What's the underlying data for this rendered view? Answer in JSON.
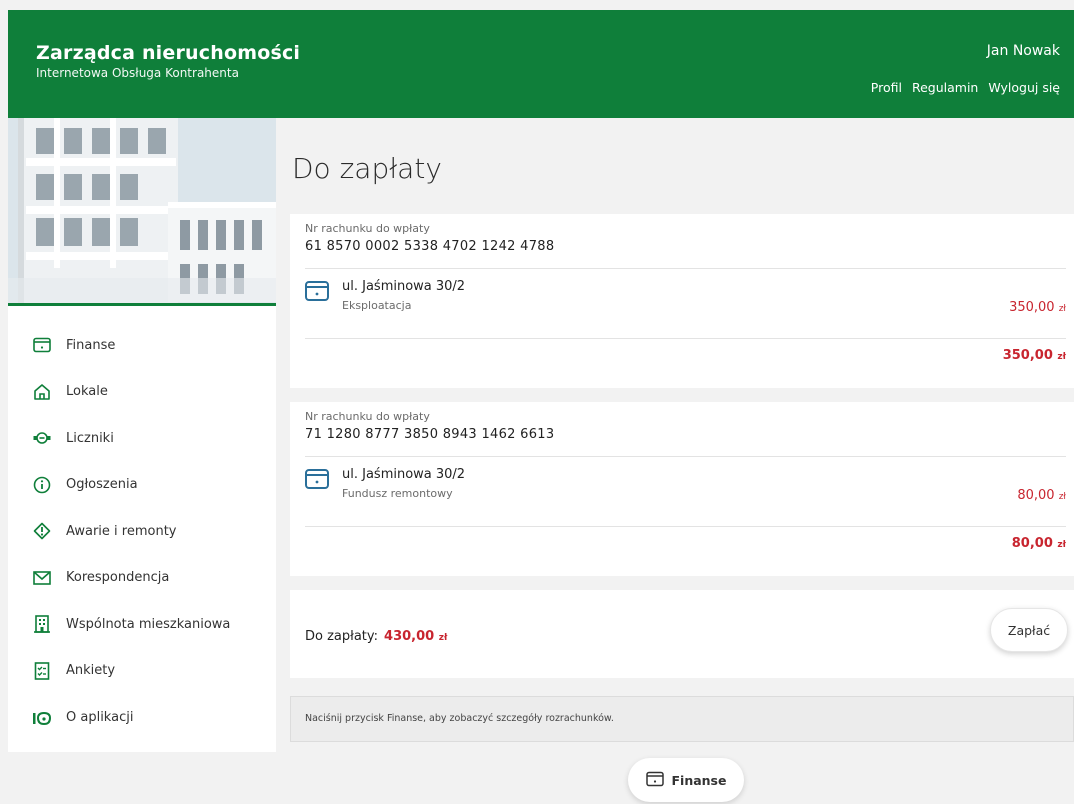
{
  "header": {
    "title": "Zarządca nieruchomości",
    "subtitle": "Internetowa Obsługa Kontrahenta",
    "user_name": "Jan Nowak",
    "links": [
      "Profil",
      "Regulamin",
      "Wyloguj się"
    ]
  },
  "sidebar": {
    "items": [
      {
        "label": "Finanse",
        "icon": "wallet-icon"
      },
      {
        "label": "Lokale",
        "icon": "home-icon"
      },
      {
        "label": "Liczniki",
        "icon": "meter-icon"
      },
      {
        "label": "Ogłoszenia",
        "icon": "info-icon"
      },
      {
        "label": "Awarie i remonty",
        "icon": "alert-icon"
      },
      {
        "label": "Korespondencja",
        "icon": "mail-icon"
      },
      {
        "label": "Wspólnota mieszkaniowa",
        "icon": "building-icon"
      },
      {
        "label": "Ankiety",
        "icon": "checklist-icon"
      },
      {
        "label": "O aplikacji",
        "icon": "about-icon"
      }
    ]
  },
  "main": {
    "title": "Do zapłaty",
    "accounts": [
      {
        "label": "Nr rachunku do wpłaty",
        "number": "61 8570 0002 5338 4702 1242 4788",
        "item_title": "ul. Jaśminowa 30/2",
        "item_sub": "Eksploatacja",
        "amount": "350,00",
        "total": "350,00"
      },
      {
        "label": "Nr rachunku do wpłaty",
        "number": "71 1280 8777 3850 8943 1462 6613",
        "item_title": "ul. Jaśminowa 30/2",
        "item_sub": "Fundusz remontowy",
        "amount": "80,00",
        "total": "80,00"
      }
    ],
    "currency": "zł",
    "pay": {
      "label": "Do zapłaty:",
      "total": "430,00",
      "button": "Zapłać"
    },
    "info": "Naciśnij przycisk Finanse, aby zobaczyć szczegóły rozrachunków.",
    "bottom_button": "Finanse"
  },
  "colors": {
    "brand": "#0f7f3a",
    "amount": "#c8252f",
    "icon": "#2a6f9a"
  }
}
